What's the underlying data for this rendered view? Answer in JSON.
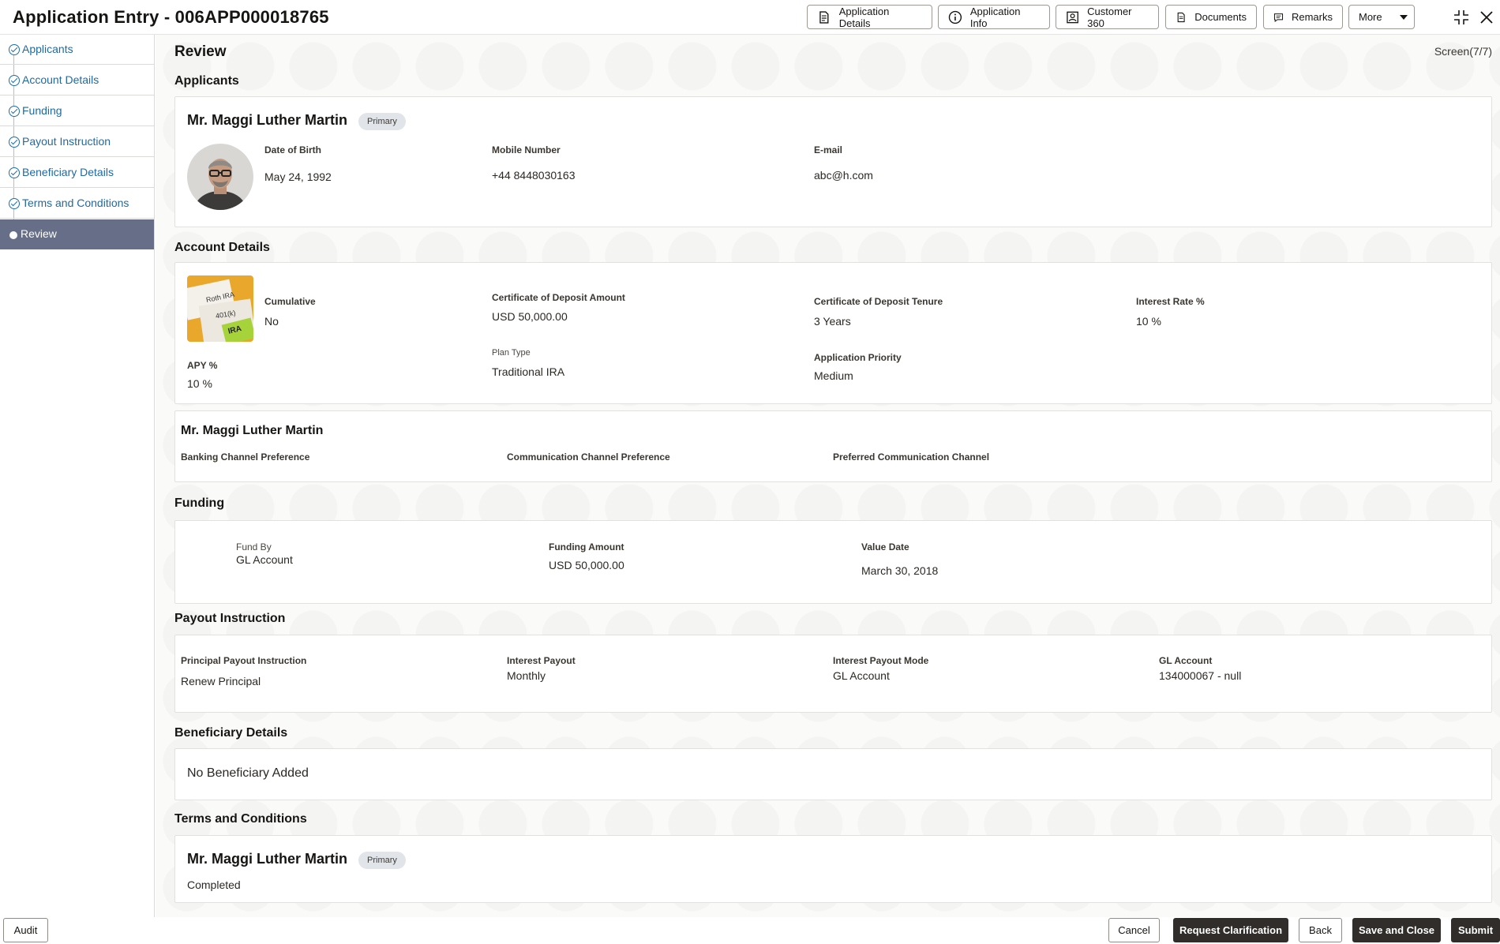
{
  "header": {
    "title": "Application Entry - 006APP000018765",
    "buttons": {
      "application_details": "Application Details",
      "application_info": "Application Info",
      "customer_360": "Customer 360",
      "documents": "Documents",
      "remarks": "Remarks",
      "more": "More"
    }
  },
  "sidebar": {
    "items": [
      {
        "label": "Applicants"
      },
      {
        "label": "Account Details"
      },
      {
        "label": "Funding"
      },
      {
        "label": "Payout Instruction"
      },
      {
        "label": "Beneficiary Details"
      },
      {
        "label": "Terms and Conditions"
      },
      {
        "label": "Review"
      }
    ]
  },
  "main": {
    "title": "Review",
    "screen": "Screen(7/7)",
    "applicants": {
      "section_title": "Applicants",
      "name": "Mr. Maggi Luther Martin",
      "badge": "Primary",
      "dob_label": "Date of Birth",
      "dob_value": "May 24, 1992",
      "mobile_label": "Mobile Number",
      "mobile_value": "+44 8448030163",
      "email_label": "E-mail",
      "email_value": "abc@h.com"
    },
    "account": {
      "section_title": "Account Details",
      "image_labels": [
        "Roth IRA",
        "401(k)",
        "IRA"
      ],
      "cumulative_label": "Cumulative",
      "cumulative_value": "No",
      "cd_amount_label": "Certificate of Deposit Amount",
      "cd_amount_value": "USD 50,000.00",
      "cd_tenure_label": "Certificate of Deposit Tenure",
      "cd_tenure_value": "3 Years",
      "interest_label": "Interest Rate %",
      "interest_value": "10 %",
      "apy_label": "APY %",
      "apy_value": "10 %",
      "plan_label": "Plan Type",
      "plan_value": "Traditional IRA",
      "priority_label": "Application Priority",
      "priority_value": "Medium"
    },
    "channel": {
      "name": "Mr. Maggi Luther Martin",
      "banking_label": "Banking Channel Preference",
      "communication_label": "Communication Channel Preference",
      "preferred_label": "Preferred Communication Channel"
    },
    "funding": {
      "section_title": "Funding",
      "fund_by_label": "Fund By",
      "fund_by_value": "GL Account",
      "amount_label": "Funding Amount",
      "amount_value": "USD 50,000.00",
      "value_date_label": "Value Date",
      "value_date_value": "March 30, 2018"
    },
    "payout": {
      "section_title": "Payout Instruction",
      "principal_label": "Principal Payout Instruction",
      "principal_value": "Renew Principal",
      "interest_payout_label": "Interest Payout",
      "interest_payout_value": "Monthly",
      "mode_label": "Interest Payout Mode",
      "mode_value": "GL Account",
      "gl_label": "GL Account",
      "gl_value": "134000067 - null"
    },
    "beneficiary": {
      "section_title": "Beneficiary Details",
      "empty_text": "No Beneficiary Added"
    },
    "terms": {
      "section_title": "Terms and Conditions",
      "name": "Mr. Maggi Luther Martin",
      "badge": "Primary",
      "status": "Completed"
    }
  },
  "footer": {
    "audit": "Audit",
    "cancel": "Cancel",
    "request_clarification": "Request Clarification",
    "back": "Back",
    "save_close": "Save and Close",
    "submit": "Submit"
  }
}
